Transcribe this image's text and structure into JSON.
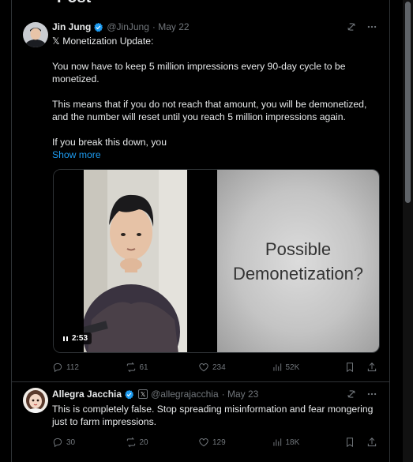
{
  "page": {
    "title": "Post"
  },
  "tweets": [
    {
      "author": "Jin Jung",
      "handle": "@JinJung",
      "date": "· May 22",
      "lines": [
        "𝕏 Monetization Update:",
        "",
        "You now have to keep 5 million impressions every 90-day cycle to be monetized.",
        "",
        "This means that if you do not reach that amount, you will be demonetized, and the number will reset until you reach 5 million impressions again.",
        "",
        "If you break this down, you"
      ],
      "show_more": "Show more",
      "media": {
        "duration": "2:53",
        "slide_line1": "Possible",
        "slide_line2": "Demonetization?"
      },
      "stats": {
        "replies": "112",
        "reposts": "61",
        "likes": "234",
        "views": "52K"
      }
    },
    {
      "author": "Allegra Jacchia",
      "handle": "@allegrajacchia",
      "date": "· May 23",
      "badge": "𝕏",
      "text": "This is completely false. Stop spreading misinformation and fear mongering just to farm impressions.",
      "stats": {
        "replies": "30",
        "reposts": "20",
        "likes": "129",
        "views": "18K"
      }
    }
  ],
  "colors": {
    "background": "#000000",
    "text": "#e7e9ea",
    "muted": "#71767b",
    "accent": "#1d9bf0",
    "border": "#2f3336"
  }
}
